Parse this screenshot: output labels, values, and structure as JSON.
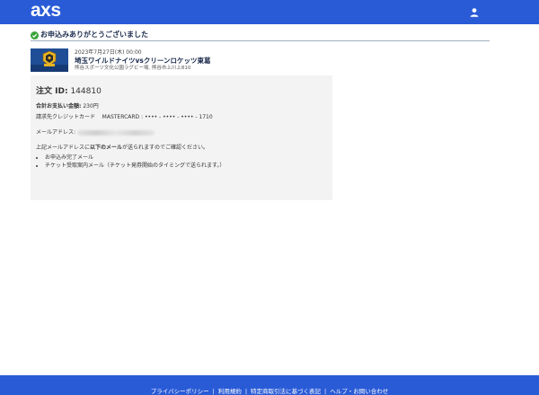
{
  "header": {
    "logo_text": "axs",
    "user_icon": "user-icon",
    "background": "#2a5bd7"
  },
  "confirmation": {
    "icon": "check-circle-icon",
    "message": "お申込みありがとうございました"
  },
  "event": {
    "date": "2023年7月27日(木) 00:00",
    "title": "埼玉ワイルドナイツvsクリーンロケッツ東葛",
    "venue": "熊谷スポーツ文化公園ラグビー場, 熊谷市上川上810"
  },
  "order": {
    "id_label": "注文 ID:",
    "id_value": "144810",
    "total_label": "合計お支払い金額:",
    "total_value": "230円",
    "card_label": "請求先クレジットカード",
    "card_value": "MASTERCARD : •••• - •••• - •••• - 1710",
    "email_label": "メールアドレス:",
    "notice_prefix": "上記メールアドレスに",
    "notice_bold": "以下のメール",
    "notice_suffix": "が送られますのでご確認ください。",
    "emails": [
      "お申込み完了メール",
      "チケット受取案内メール（チケット発券開始のタイミングで送られます。）"
    ]
  },
  "footer": {
    "links": [
      "プライバシーポリシー",
      "利用規約",
      "特定商取引法に基づく表記",
      "ヘルプ・お問い合わせ"
    ]
  }
}
